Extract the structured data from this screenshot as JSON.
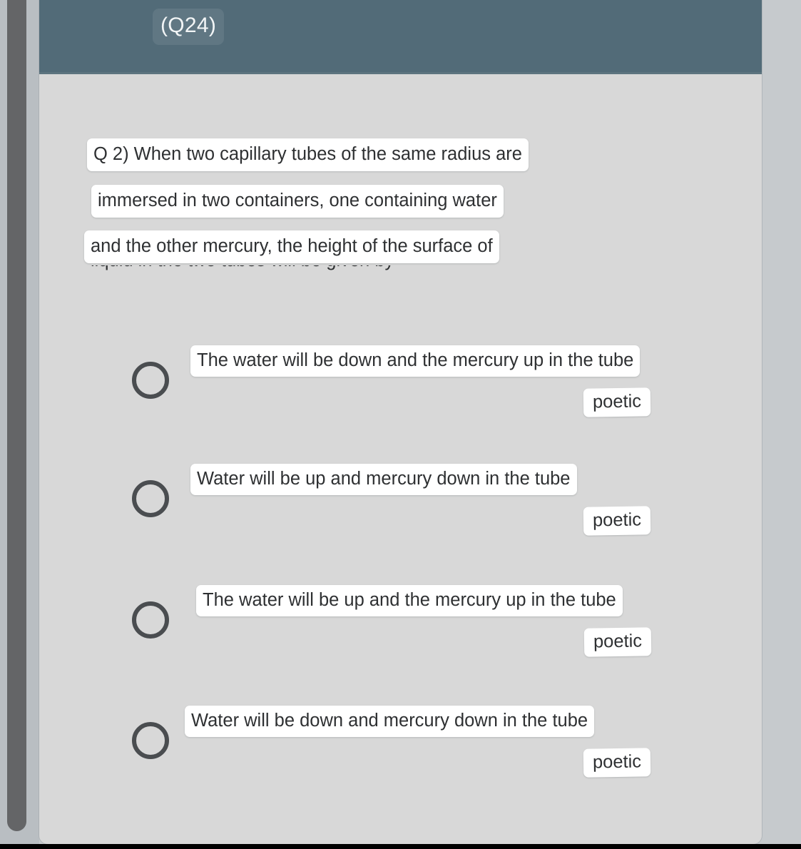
{
  "window": {
    "question_badge": "(Q24)"
  },
  "question": {
    "lines": [
      "Q 2) When two capillary tubes of the same radius are",
      "immersed in two containers, one containing water",
      "and the other mercury, the height of the surface of"
    ],
    "clipped_line": "liquid in the two tubes will be given by"
  },
  "options": [
    {
      "label": "The water will be down and the mercury up in the tube",
      "tag": "poetic",
      "selected": false
    },
    {
      "label": "Water will be up and mercury down in the tube",
      "tag": "poetic",
      "selected": false
    },
    {
      "label": "The water will be up and the mercury up in the tube",
      "tag": "poetic",
      "selected": false
    },
    {
      "label": "Water will be down and mercury down in the tube",
      "tag": "poetic",
      "selected": false
    }
  ],
  "colors": {
    "header": "#526b78",
    "page_background": "#d8d8d8",
    "outer_background": "#c6cacd",
    "scrollbar_thumb": "#646567",
    "highlight": "#ffffff",
    "text": "#2e3032"
  }
}
